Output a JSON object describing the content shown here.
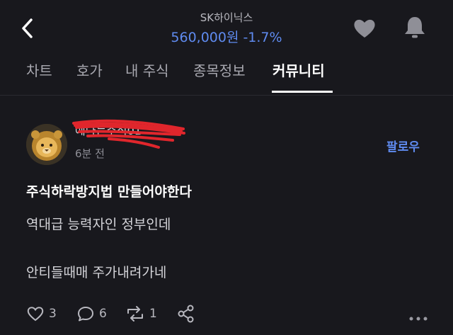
{
  "header": {
    "stock_name": "SK하이닉스",
    "price": "560,000원",
    "change": "-1.7%"
  },
  "tabs": [
    {
      "label": "차트"
    },
    {
      "label": "호가"
    },
    {
      "label": "내 주식"
    },
    {
      "label": "종목정보"
    },
    {
      "label": "커뮤니티",
      "active": true
    }
  ],
  "post": {
    "username": "예나는주식01",
    "time": "6분 전",
    "follow_label": "팔로우",
    "title": "주식하락방지법 만들어야한다",
    "lines": [
      "역대급 능력자인 정부인데",
      "안티들때매 주가내려가네"
    ]
  },
  "actions": {
    "likes": "3",
    "comments": "6",
    "reposts": "1"
  },
  "colors": {
    "background": "#18181d",
    "accent": "#5f8bf0",
    "redaction": "#e0262c"
  },
  "icons": [
    "back-arrow-icon",
    "heart-icon",
    "bell-icon",
    "lion-avatar",
    "comment-icon",
    "repost-icon",
    "share-icon",
    "more-icon"
  ]
}
